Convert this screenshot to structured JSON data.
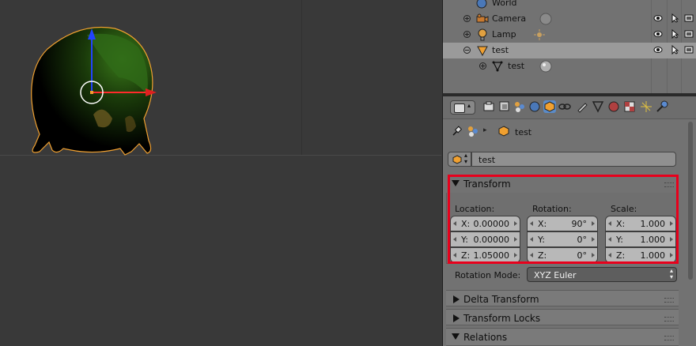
{
  "outliner": {
    "rows": [
      {
        "label": "World",
        "icon": "world-icon"
      },
      {
        "label": "Camera",
        "icon": "camera-icon"
      },
      {
        "label": "Lamp",
        "icon": "lamp-icon"
      },
      {
        "label": "test",
        "icon": "mesh-object-icon",
        "selected": true
      },
      {
        "label": "test",
        "icon": "mesh-data-icon"
      }
    ]
  },
  "properties": {
    "context_tabs": [
      "render-icon",
      "render-layers-icon",
      "scene-icon",
      "world-icon",
      "object-icon",
      "constraints-icon",
      "modifiers-icon",
      "data-icon",
      "material-icon",
      "texture-icon",
      "particles-icon",
      "physics-icon"
    ],
    "active_tab": "object-icon",
    "breadcrumb_object": "test",
    "object_name": "test",
    "transform": {
      "title": "Transform",
      "location_label": "Location:",
      "rotation_label": "Rotation:",
      "scale_label": "Scale:",
      "location": [
        {
          "k": "X:",
          "v": "0.00000"
        },
        {
          "k": "Y:",
          "v": "0.00000"
        },
        {
          "k": "Z:",
          "v": "1.05000"
        }
      ],
      "rotation": [
        {
          "k": "X:",
          "v": "90°"
        },
        {
          "k": "Y:",
          "v": "0°"
        },
        {
          "k": "Z:",
          "v": "0°"
        }
      ],
      "scale": [
        {
          "k": "X:",
          "v": "1.000"
        },
        {
          "k": "Y:",
          "v": "1.000"
        },
        {
          "k": "Z:",
          "v": "1.000"
        }
      ]
    },
    "rotation_mode_label": "Rotation Mode:",
    "rotation_mode_value": "XYZ Euler",
    "panels": [
      "Delta Transform",
      "Transform Locks",
      "Relations"
    ]
  },
  "colors": {
    "highlight": "#e8001c",
    "active_tab": "#5b8bc7",
    "selection_outline": "#f0a030"
  }
}
